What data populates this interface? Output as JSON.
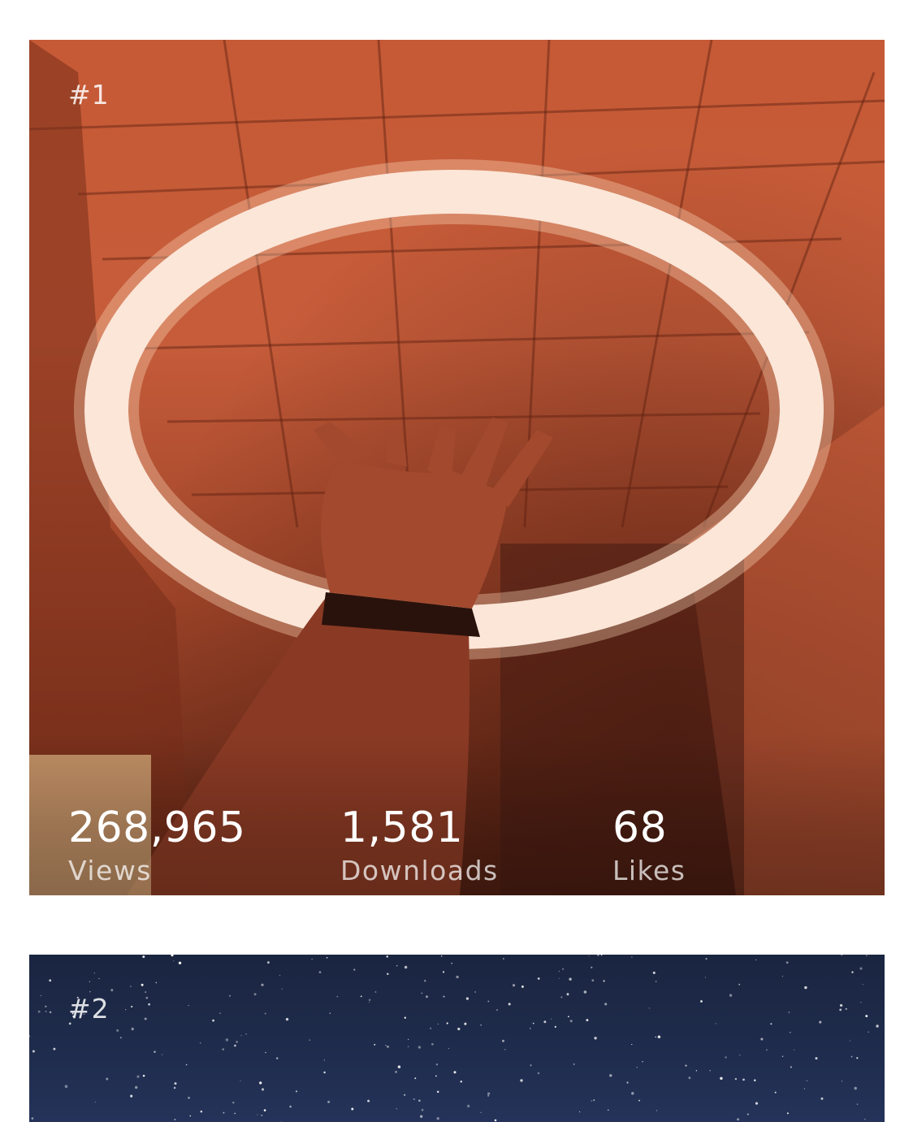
{
  "feed": {
    "cards": [
      {
        "rank": "#1",
        "stats": {
          "views": {
            "value": "268,965",
            "label": "Views"
          },
          "downloads": {
            "value": "1,581",
            "label": "Downloads"
          },
          "likes": {
            "value": "68",
            "label": "Likes"
          }
        },
        "photo_subject": "hand reaching toward glowing ring light"
      },
      {
        "rank": "#2",
        "photo_subject": "starry night sky"
      }
    ]
  },
  "colors": {
    "page_background": "#ffffff",
    "card1_tone": "#c65a36",
    "card2_tone": "#1f2c4d",
    "stat_value": "#ffffff"
  }
}
